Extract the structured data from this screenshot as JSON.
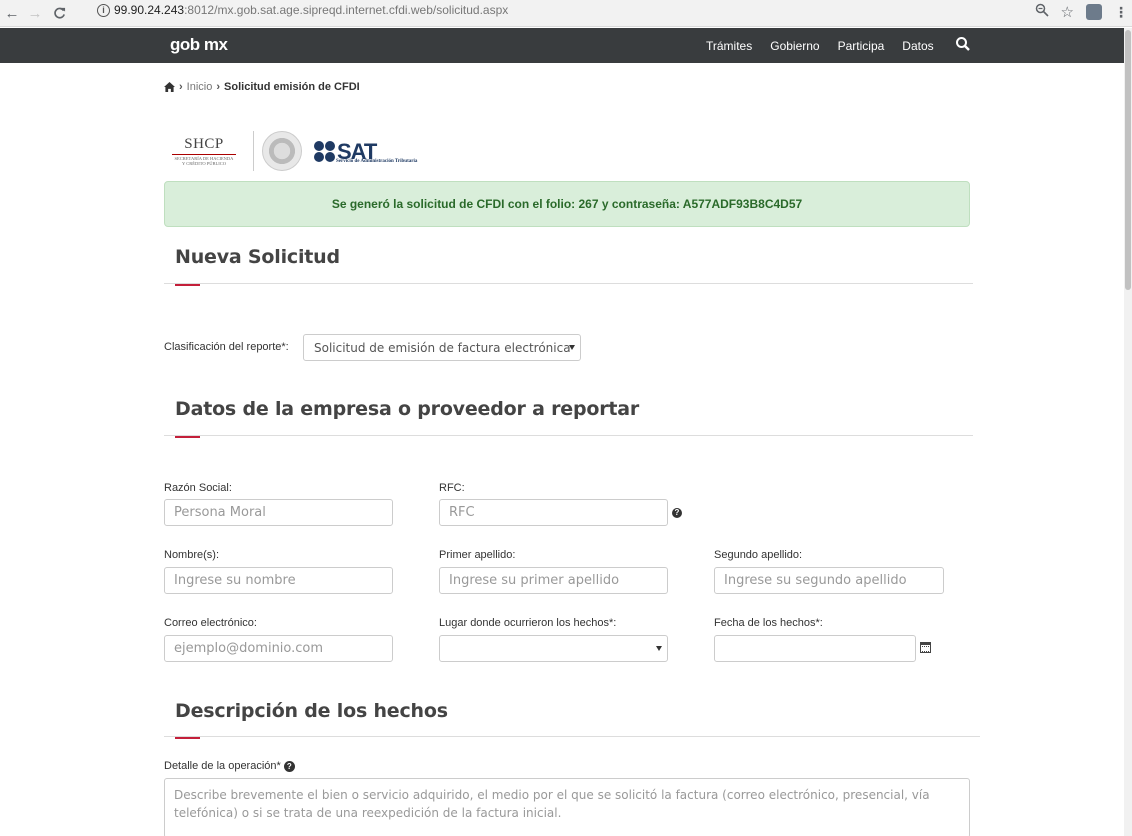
{
  "browser": {
    "url_host": "99.90.24.243",
    "url_path": ":8012/mx.gob.sat.age.sipreqd.internet.cfdi.web/solicitud.aspx"
  },
  "header": {
    "brand": "gob mx",
    "nav": [
      "Trámites",
      "Gobierno",
      "Participa",
      "Datos"
    ],
    "bar_color": "#393c3e"
  },
  "breadcrumb": {
    "home": "Inicio",
    "current": "Solicitud emisión de CFDI"
  },
  "logos": {
    "shcp": "SHCP",
    "shcp_sub1": "SECRETARÍA DE HACIENDA",
    "shcp_sub2": "Y CRÉDITO PÚBLICO",
    "sat": "SAT",
    "sat_sub": "Servicio de Administración Tributaria"
  },
  "alert": {
    "message": "Se generó la solicitud de CFDI con el folio: 267 y contraseña: A577ADF93B8C4D57",
    "color": "#d9eeda"
  },
  "section1": {
    "title": "Nueva Solicitud",
    "class_label": "Clasificación del reporte*:",
    "class_value": "Solicitud de emisión de factura electrónica"
  },
  "section2": {
    "title": "Datos de la empresa o proveedor a reportar",
    "razon_label": "Razón Social:",
    "razon_placeholder": "Persona Moral",
    "rfc_label": "RFC:",
    "rfc_placeholder": "RFC",
    "nombre_label": "Nombre(s):",
    "nombre_placeholder": "Ingrese su nombre",
    "primer_label": "Primer apellido:",
    "primer_placeholder": "Ingrese su primer apellido",
    "segundo_label": "Segundo apellido:",
    "segundo_placeholder": "Ingrese su segundo apellido",
    "correo_label": "Correo electrónico:",
    "correo_placeholder": "ejemplo@dominio.com",
    "lugar_label": "Lugar donde ocurrieron los hechos*:",
    "lugar_value": "",
    "fecha_label": "Fecha de los hechos*:",
    "fecha_value": ""
  },
  "section3": {
    "title": "Descripción de los hechos",
    "detalle_label": "Detalle de la operación*",
    "detalle_placeholder": "Describe brevemente el bien o servicio adquirido, el medio por el que se solicitó la factura (correo electrónico, presencial, vía telefónica) o si se trata de una reexpedición de la factura inicial."
  },
  "accent_red": "#c41f3a"
}
